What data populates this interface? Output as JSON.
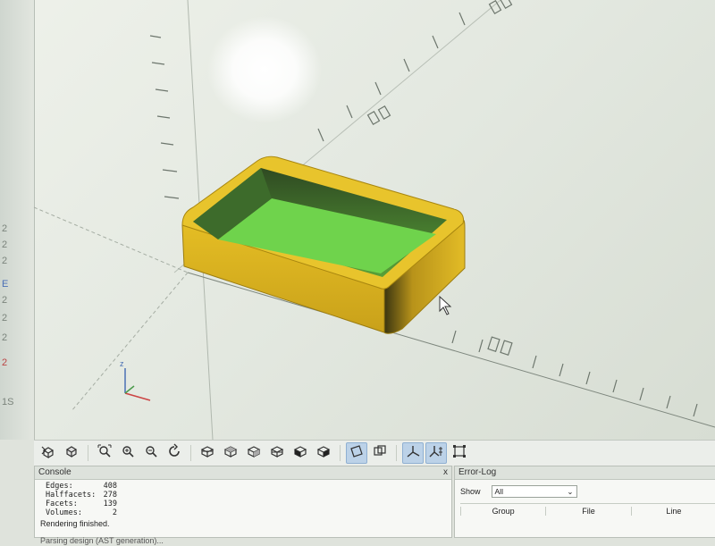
{
  "viewport": {
    "axis_labels_top": "00",
    "axis_labels_mid": "00",
    "axis_labels_x": "00",
    "left_labels": [
      "2",
      "2",
      "2",
      "E",
      "2",
      "2",
      "2",
      "2",
      "1S"
    ]
  },
  "toolbar": {
    "buttons": [
      {
        "icon": "preview-icon"
      },
      {
        "icon": "render-icon"
      },
      {
        "icon": "zoom-all-icon"
      },
      {
        "icon": "zoom-in-icon"
      },
      {
        "icon": "zoom-out-icon"
      },
      {
        "icon": "reset-view-icon"
      },
      {
        "icon": "view-right-icon"
      },
      {
        "icon": "view-top-icon"
      },
      {
        "icon": "view-bottom-icon"
      },
      {
        "icon": "view-left-icon"
      },
      {
        "icon": "view-front-icon"
      },
      {
        "icon": "view-back-icon"
      },
      {
        "icon": "perspective-icon",
        "active": true
      },
      {
        "icon": "orthogonal-icon"
      },
      {
        "icon": "show-axes-icon",
        "active": true
      },
      {
        "icon": "show-scale-icon",
        "active": true
      },
      {
        "icon": "show-edges-icon"
      }
    ]
  },
  "console": {
    "title": "Console",
    "close": "x",
    "stats": [
      {
        "label": "Edges:",
        "value": "408"
      },
      {
        "label": "Halffacets:",
        "value": "278"
      },
      {
        "label": "Facets:",
        "value": "139"
      },
      {
        "label": "Volumes:",
        "value": "2"
      }
    ],
    "message": "Rendering finished.",
    "next_message": "Parsing design (AST generation)..."
  },
  "error_log": {
    "title": "Error-Log",
    "show_label": "Show",
    "show_value": "All",
    "columns": [
      "Group",
      "File",
      "Line"
    ]
  },
  "colors": {
    "model_yellow": "#dcb420",
    "model_green": "#6ed24a",
    "accent_blue": "#4a6fb5"
  }
}
